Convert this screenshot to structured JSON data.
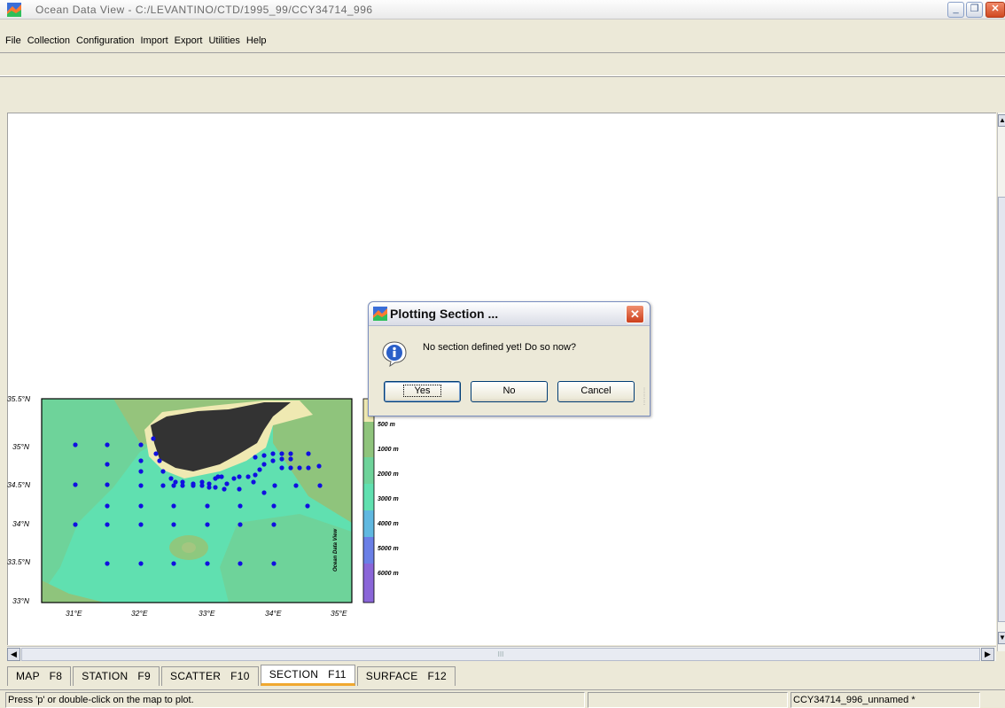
{
  "window": {
    "title": "Ocean Data View - C:/LEVANTINO/CTD/1995_99/CCY34714_996",
    "controls": {
      "minimize": "_",
      "maximize": "❐",
      "close": "✕"
    }
  },
  "menu": [
    "File",
    "Collection",
    "Configuration",
    "Import",
    "Export",
    "Utilities",
    "Help"
  ],
  "dialog": {
    "title": "Plotting Section ...",
    "message": "No section defined yet!  Do so now?",
    "buttons": {
      "yes": "Yes",
      "no": "No",
      "cancel": "Cancel"
    },
    "icon": "info-icon"
  },
  "map": {
    "lat_labels": [
      "35.5°N",
      "35°N",
      "34.5°N",
      "34°N",
      "33.5°N",
      "33°N"
    ],
    "lon_labels": [
      "31°E",
      "32°E",
      "33°E",
      "34°E",
      "35°E"
    ],
    "depth_scale": [
      "500 m",
      "1000 m",
      "2000 m",
      "3000 m",
      "4000 m",
      "5000 m",
      "6000 m"
    ],
    "watermark": "Ocean Data View",
    "colors": {
      "land": "#333333",
      "shelf": "#efe9b2",
      "shallow": "#9cc87a",
      "mid": "#6fd19a",
      "deep": "#60e0b0",
      "station": "#1010e0"
    }
  },
  "tabs": [
    {
      "label": "MAP   F8",
      "active": false
    },
    {
      "label": "STATION   F9",
      "active": false
    },
    {
      "label": "SCATTER   F10",
      "active": false
    },
    {
      "label": "SECTION   F11",
      "active": true
    },
    {
      "label": "SURFACE   F12",
      "active": false
    }
  ],
  "status": {
    "hint": "Press 'p' or double-click on the map to plot.",
    "middle": "",
    "collection": "CCY34714_996_unnamed *"
  },
  "scroll": {
    "grip": "III"
  }
}
